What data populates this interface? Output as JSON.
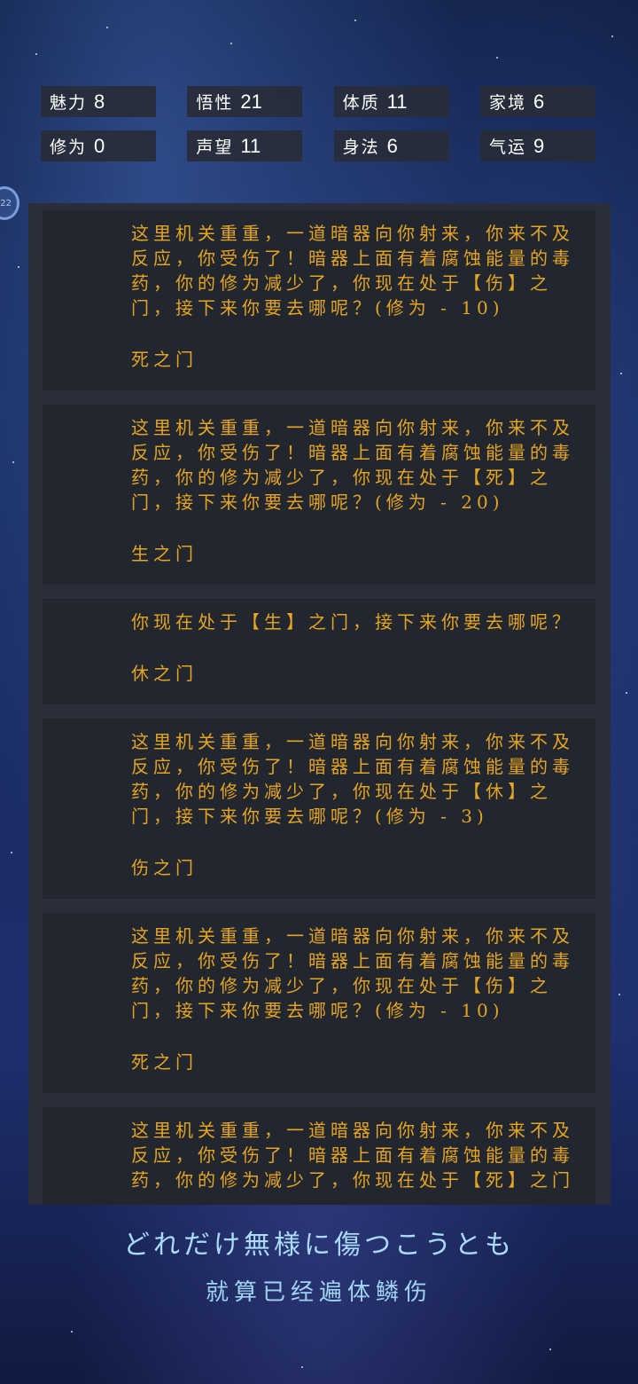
{
  "stats": [
    [
      {
        "label": "魅力",
        "value": "8"
      },
      {
        "label": "悟性",
        "value": "21"
      },
      {
        "label": "体质",
        "value": "11"
      },
      {
        "label": "家境",
        "value": "6"
      }
    ],
    [
      {
        "label": "修为",
        "value": "0"
      },
      {
        "label": "声望",
        "value": "11"
      },
      {
        "label": "身法",
        "value": "6"
      },
      {
        "label": "气运",
        "value": "9"
      }
    ]
  ],
  "side_badge": "22",
  "log": [
    {
      "text": "这里机关重重，一道暗器向你射来，你来不及反应，你受伤了！暗器上面有着腐蚀能量的毒药，你的修为减少了，你现在处于【伤】之门，接下来你要去哪呢？(修为 - 10)",
      "choice": "死之门"
    },
    {
      "text": "这里机关重重，一道暗器向你射来，你来不及反应，你受伤了！暗器上面有着腐蚀能量的毒药，你的修为减少了，你现在处于【死】之门，接下来你要去哪呢？(修为 - 20)",
      "choice": "生之门"
    },
    {
      "text": "你现在处于【生】之门，接下来你要去哪呢？",
      "choice": "休之门"
    },
    {
      "text": "这里机关重重，一道暗器向你射来，你来不及反应，你受伤了！暗器上面有着腐蚀能量的毒药，你的修为减少了，你现在处于【休】之门，接下来你要去哪呢？(修为 - 3)",
      "choice": "伤之门"
    },
    {
      "text": "这里机关重重，一道暗器向你射来，你来不及反应，你受伤了！暗器上面有着腐蚀能量的毒药，你的修为减少了，你现在处于【伤】之门，接下来你要去哪呢？(修为 - 10)",
      "choice": "死之门"
    },
    {
      "text": "这里机关重重，一道暗器向你射来，你来不及反应，你受伤了！暗器上面有着腐蚀能量的毒药，你的修为减少了，你现在处于【死】之门",
      "choice": ""
    }
  ],
  "lyrics": {
    "japanese": "どれだけ無様に傷つこうとも",
    "chinese": "就算已经遍体鳞伤"
  },
  "colors": {
    "log_text": "#e5a521",
    "panel_bg": "#2a2e38",
    "item_bg": "#22262f",
    "lyric": "#a9dcf6"
  }
}
